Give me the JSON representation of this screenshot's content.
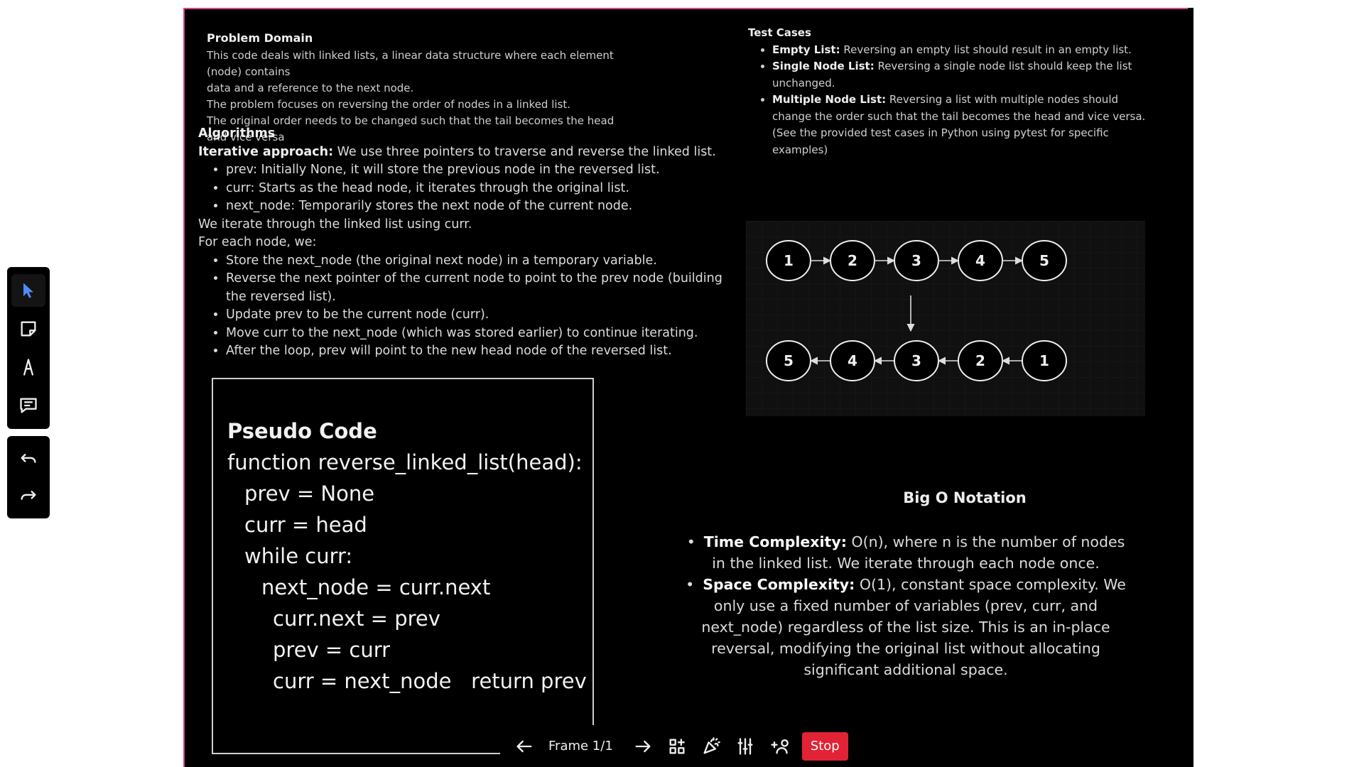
{
  "problem_domain": {
    "title": "Problem Domain",
    "lines": [
      "This code deals with linked lists, a linear data structure where each element (node) contains",
      "data and a reference to the next node.",
      "The problem focuses on reversing the order of nodes in a linked list.",
      "The original order needs to be changed such that the tail becomes the head and vice versa"
    ]
  },
  "algorithms": {
    "title": "Algorithms",
    "approach_label": "Iterative approach:",
    "approach_text": " We use three pointers to traverse and reverse the linked list.",
    "pointers": [
      "prev: Initially None, it will store the previous node in the reversed list.",
      "curr: Starts as the head node, it iterates through the original list.",
      "next_node: Temporarily stores the next node of the current node."
    ],
    "iterate_line": "We iterate through the linked list using curr.",
    "each_line": "For each node, we:",
    "steps": [
      "Store the next_node (the original next node) in a temporary variable.",
      "Reverse the next pointer of the current node to point to the prev node (building the reversed list).",
      "Update prev to be the current node (curr).",
      "Move curr to the next_node (which was stored earlier) to continue iterating.",
      "After the loop, prev will point to the new head node of the reversed list."
    ]
  },
  "test_cases": {
    "title": "Test Cases",
    "items": [
      {
        "label": "Empty List:",
        "text": " Reversing an empty list should result in an empty list."
      },
      {
        "label": "Single Node List:",
        "text": " Reversing a single node list should keep the list unchanged."
      },
      {
        "label": "Multiple Node List:",
        "text": " Reversing a list with multiple nodes should change the order such that the tail becomes the head and vice versa. (See the provided test cases in Python using pytest for specific examples)"
      }
    ]
  },
  "diagram": {
    "top_nodes": [
      "1",
      "2",
      "3",
      "4",
      "5"
    ],
    "bottom_nodes": [
      "5",
      "4",
      "3",
      "2",
      "1"
    ]
  },
  "pseudo_code": {
    "title": "Pseudo Code",
    "lines": [
      "function reverse_linked_list(head):",
      "prev = None",
      "curr = head",
      "while curr:",
      "next_node = curr.next",
      "curr.next = prev",
      "prev = curr",
      "curr = next_node   return prev"
    ]
  },
  "big_o": {
    "title": "Big O Notation",
    "time_label": "Time Complexity:",
    "time_text": " O(n), where n is the number of nodes in the linked list. We iterate through each node once.",
    "space_label": "Space Complexity:",
    "space_text": " O(1), constant space complexity. We only use a fixed number of variables (prev, curr, and next_node) regardless of the list size. This is an in-place reversal, modifying the original list without allocating significant additional space."
  },
  "toolbar": {
    "tools": [
      "select-icon",
      "sticky-note-icon",
      "pen-icon",
      "comment-icon"
    ],
    "history": [
      "undo-icon",
      "redo-icon"
    ]
  },
  "presentation": {
    "frame_label": "Frame 1/1",
    "stop_label": "Stop"
  },
  "colors": {
    "board_border": "#d9468e",
    "stop": "#e12335",
    "select_tool": "#4d8df6"
  }
}
